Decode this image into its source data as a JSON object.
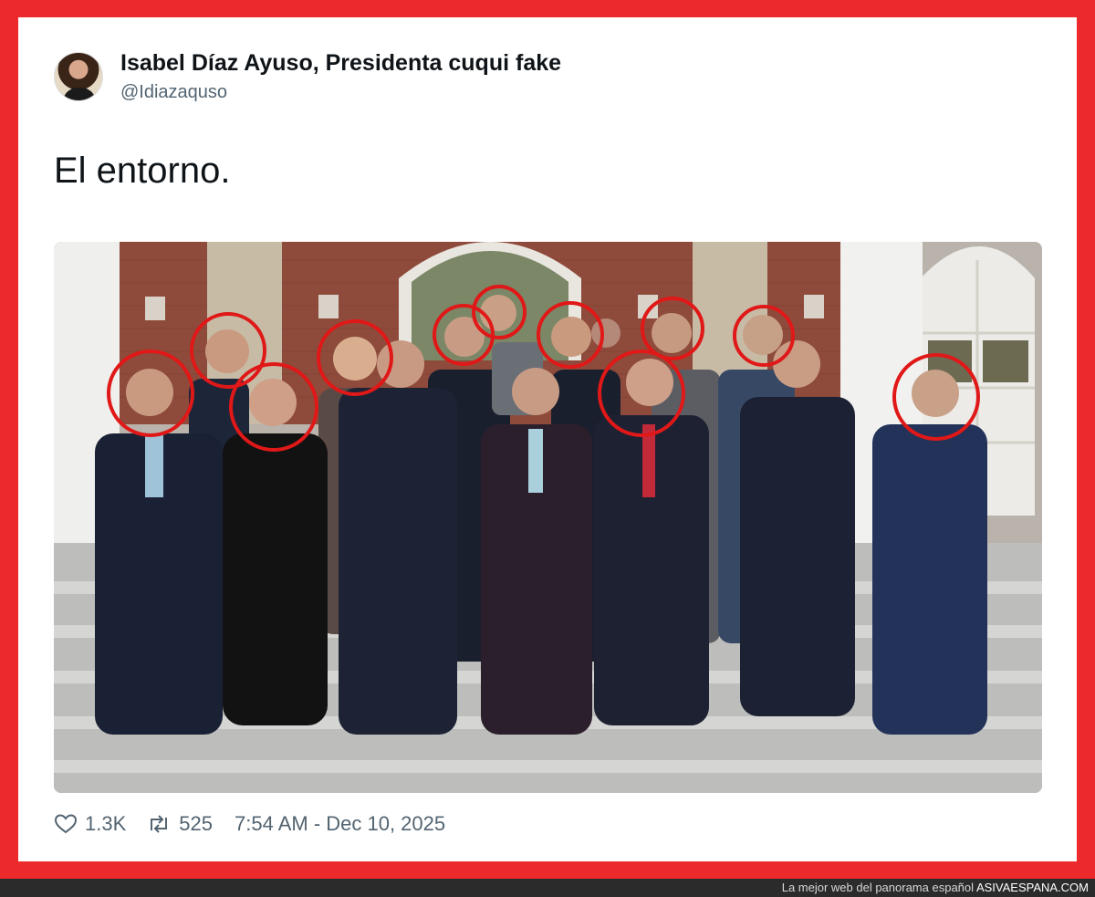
{
  "tweet": {
    "author_name": "Isabel Díaz Ayuso, Presidenta cuqui fake",
    "handle": "@Idiazaquso",
    "text": "El entorno.",
    "likes": "1.3K",
    "retweets": "525",
    "timestamp": "7:54 AM - Dec 10, 2025"
  },
  "watermark": {
    "tagline": "La mejor web del panorama español",
    "site": "ASIVAESPANA.COM"
  },
  "colors": {
    "frame": "#ed2a2b",
    "circle_highlight": "#e01818",
    "text_primary": "#0f1419",
    "text_secondary": "#536471"
  },
  "icons": [
    "heart-icon",
    "retweet-icon"
  ]
}
